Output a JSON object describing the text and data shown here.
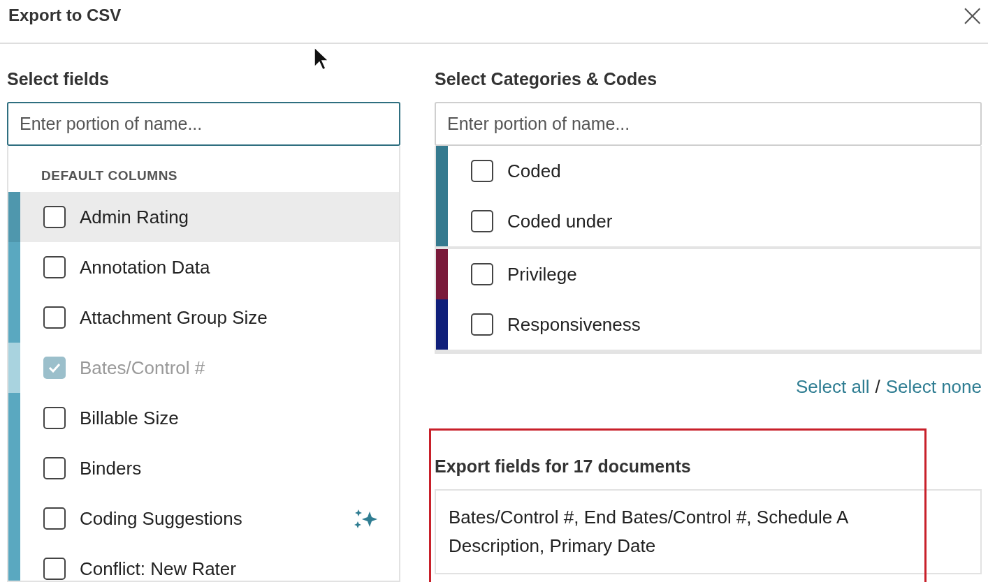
{
  "dialog": {
    "title": "Export to CSV",
    "close": "×"
  },
  "fields": {
    "heading": "Select fields",
    "search": {
      "placeholder": "Enter portion of name...",
      "focused": true
    },
    "section": "DEFAULT COLUMNS",
    "items": [
      {
        "label": "Admin Rating",
        "checked": false,
        "disabled": false,
        "highlighted": true,
        "sparkle": false,
        "color": "#4f97ad"
      },
      {
        "label": "Annotation Data",
        "checked": false,
        "disabled": false,
        "highlighted": false,
        "sparkle": false,
        "color": "#5aa8c0"
      },
      {
        "label": "Attachment Group Size",
        "checked": false,
        "disabled": false,
        "highlighted": false,
        "sparkle": false,
        "color": "#5aa8c0"
      },
      {
        "label": "Bates/Control #",
        "checked": true,
        "disabled": true,
        "highlighted": false,
        "sparkle": false,
        "color": "#a9d3df"
      },
      {
        "label": "Billable Size",
        "checked": false,
        "disabled": false,
        "highlighted": false,
        "sparkle": false,
        "color": "#5aa8c0"
      },
      {
        "label": "Binders",
        "checked": false,
        "disabled": false,
        "highlighted": false,
        "sparkle": false,
        "color": "#5aa8c0"
      },
      {
        "label": "Coding Suggestions",
        "checked": false,
        "disabled": false,
        "highlighted": false,
        "sparkle": true,
        "color": "#5aa8c0"
      },
      {
        "label": "Conflict: New Rater",
        "checked": false,
        "disabled": false,
        "highlighted": false,
        "sparkle": false,
        "color": "#5aa8c0"
      }
    ]
  },
  "categories": {
    "heading": "Select Categories & Codes",
    "search": {
      "placeholder": "Enter portion of name...",
      "focused": false
    },
    "groups": [
      {
        "items": [
          {
            "label": "Coded",
            "checked": false,
            "color": "#357a8f"
          },
          {
            "label": "Coded under",
            "checked": false,
            "color": "#357a8f"
          }
        ]
      },
      {
        "items": [
          {
            "label": "Privilege",
            "checked": false,
            "color": "#7a1a3a"
          },
          {
            "label": "Responsiveness",
            "checked": false,
            "color": "#0f1f7a"
          }
        ]
      }
    ],
    "select_all": "Select all",
    "separator": "/",
    "select_none": "Select none"
  },
  "export": {
    "highlighted": true,
    "heading": "Export fields for 17 documents",
    "value": "Bates/Control #, End Bates/Control #, Schedule A Description, Primary Date"
  }
}
